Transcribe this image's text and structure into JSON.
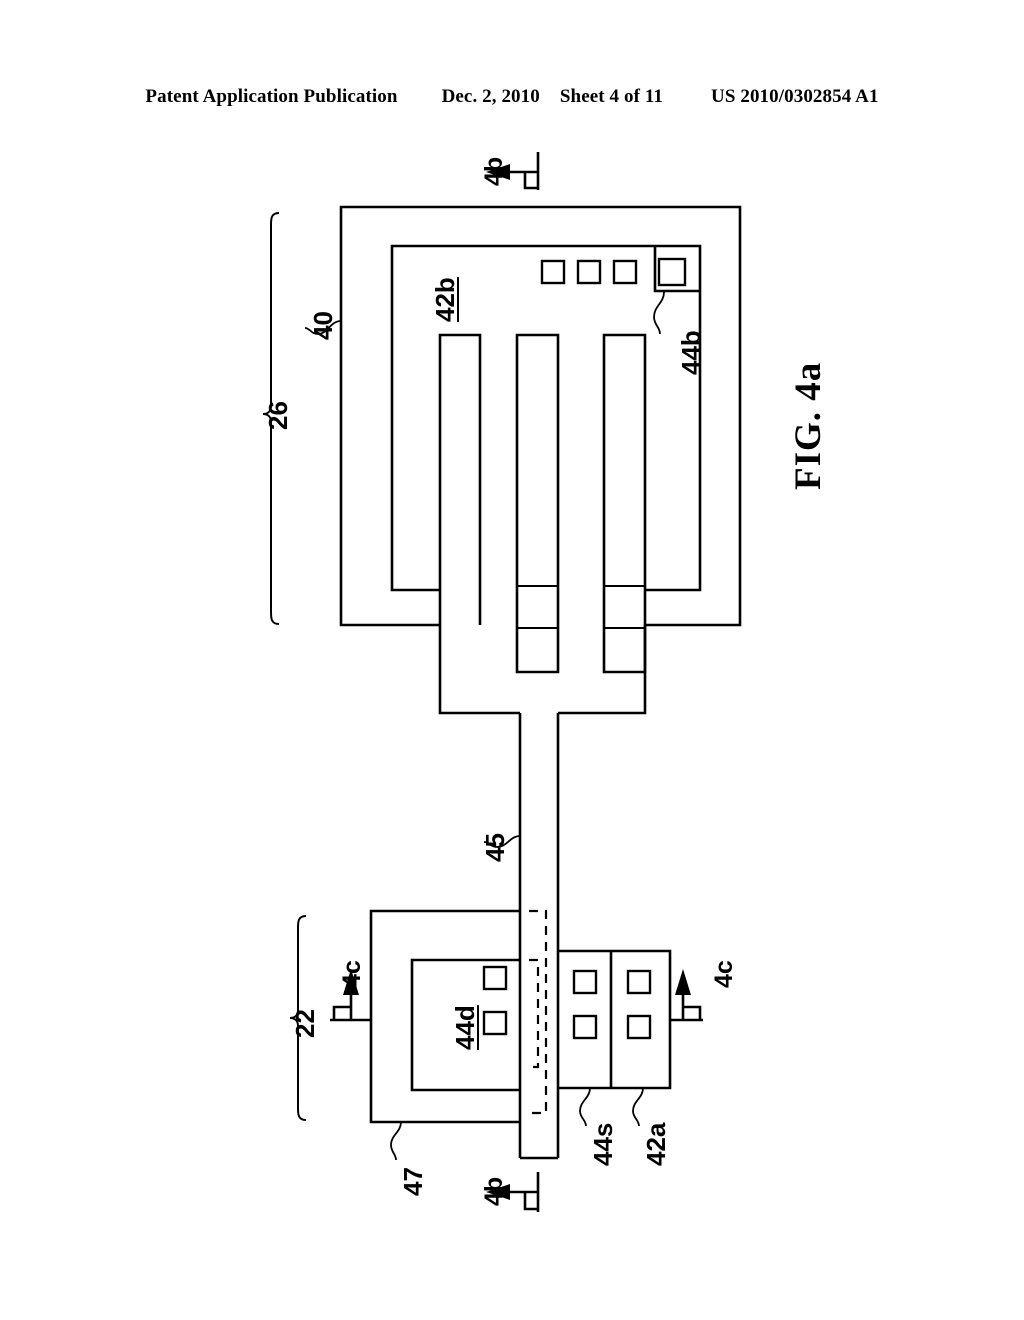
{
  "header": {
    "publication": "Patent Application Publication",
    "date": "Dec. 2, 2010",
    "sheet": "Sheet 4 of 11",
    "patent_number": "US 2010/0302854 A1"
  },
  "figure": {
    "label": "FIG. 4a",
    "caption_rotation_deg": -90
  },
  "labels": {
    "bracket_26": "26",
    "bracket_22": "22",
    "ref_40": "40",
    "ref_42b": "42b",
    "ref_44b": "44b",
    "ref_45": "45",
    "ref_47": "47",
    "ref_44d": "44d",
    "ref_44s": "44s",
    "ref_42a": "42a"
  },
  "section_markers": [
    {
      "name": "section-4b-top",
      "text": "4b",
      "direction": "left"
    },
    {
      "name": "section-4b-bottom",
      "text": "4b",
      "direction": "left"
    },
    {
      "name": "section-4c-left",
      "text": "4c",
      "direction": "up"
    },
    {
      "name": "section-4c-right",
      "text": "4c",
      "direction": "up"
    }
  ],
  "colors": {
    "ink": "#000000",
    "paper": "#ffffff"
  },
  "structures": {
    "top_assembly": {
      "outer_body_ref": "40",
      "inner_plate_ref": "42b",
      "contact_pad_count": 4,
      "highlighted_pad_ref": "44b",
      "finger_count": 3
    },
    "bottom_assembly": {
      "substrate_ref": "47",
      "die_ref": "44d",
      "die_pad_count": 2,
      "source_region_ref": "44s",
      "plate_ref": "42a",
      "pad_columns": 2,
      "pad_rows": 2
    },
    "interconnect": {
      "ref": "45",
      "description": "neck trace"
    }
  }
}
